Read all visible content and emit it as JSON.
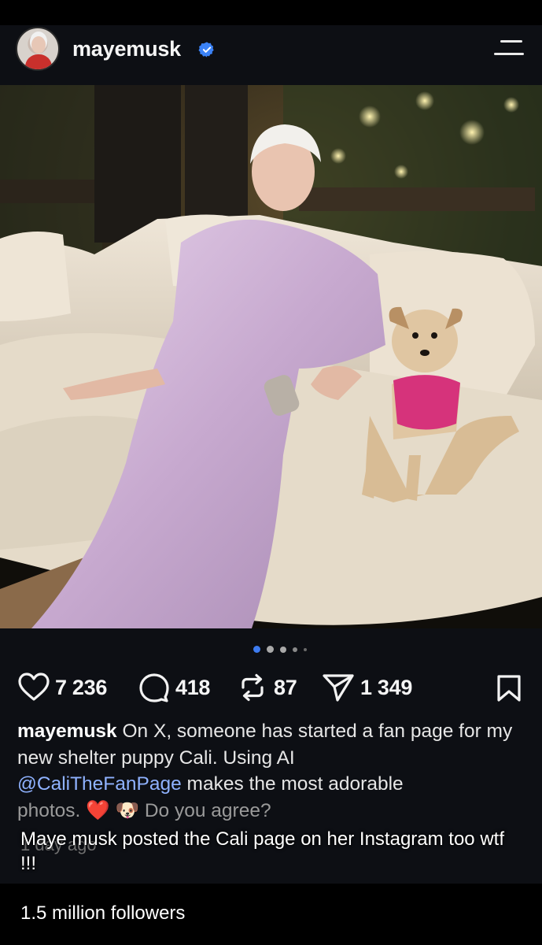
{
  "header": {
    "username": "mayemusk",
    "verified_icon": "verified-badge-icon",
    "menu_icon": "menu-icon"
  },
  "carousel": {
    "total_dots": 5,
    "active_index": 0
  },
  "actions": {
    "likes": "7 236",
    "comments": "418",
    "reposts": "87",
    "shares": "1 349",
    "icons": [
      "heart-icon",
      "comment-icon",
      "repost-icon",
      "share-icon",
      "bookmark-icon"
    ]
  },
  "caption": {
    "username": "mayemusk",
    "text_part1": "On X, someone has started a fan page for my new shelter puppy Cali. Using AI",
    "mention": "@CaliTheFanPage",
    "text_part2": "makes the most adorable",
    "text_part3": "photos.",
    "emoji1": "❤️",
    "emoji2": "🐶",
    "text_part4": "Do you agree?",
    "time_ago": "1 day ago"
  },
  "overlay": {
    "comment": "Maye musk posted the Cali page on her Instagram too wtf !!!",
    "followers": "1.5 million followers"
  },
  "colors": {
    "background": "#0d0f14",
    "verified_blue": "#3b82f6",
    "mention_blue": "#8fb2ff",
    "heart_red": "#d8323c",
    "active_dot": "#3d7bf0"
  }
}
